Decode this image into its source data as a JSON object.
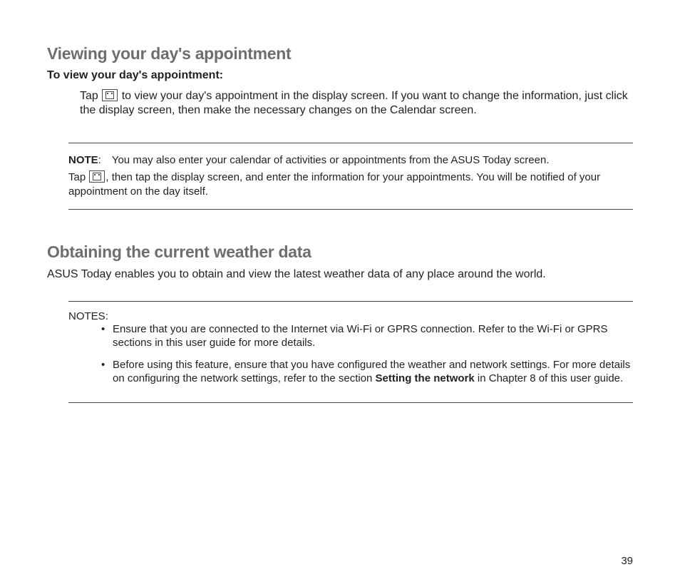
{
  "section1": {
    "heading": "Viewing your day's appointment",
    "sub": "To view your day's appointment:",
    "para_pre": "Tap ",
    "para_post": " to view your day's appointment in the display screen. If you want to change the information, just click the display screen, then make the necessary changes on the Calendar screen.",
    "icon_name": "calendar-icon"
  },
  "note1": {
    "label": "NOTE",
    "line1": ": You may also enter your calendar of activities or appointments from the ASUS Today screen.",
    "line2_pre": "Tap ",
    "line2_post": ", then tap the display screen, and enter the information for your appointments. You will be notified of your appointment on the day itself.",
    "icon_name": "calendar-icon"
  },
  "section2": {
    "heading": "Obtaining the current weather data",
    "desc": "ASUS Today enables you to obtain and view the latest weather data of any place around the world."
  },
  "note2": {
    "label": "NOTES",
    "colon": ":",
    "items": [
      {
        "pre": "Ensure that you are connected to the Internet via Wi-Fi or GPRS connection. Refer to the Wi-Fi or GPRS sections in this user guide for more details.",
        "bold": "",
        "post": ""
      },
      {
        "pre": "Before using this feature, ensure that you have configured the weather and network settings. For more details on configuring the network settings, refer to the section ",
        "bold": "Setting the network",
        "post": " in Chapter 8 of this user guide."
      }
    ]
  },
  "page_number": "39"
}
